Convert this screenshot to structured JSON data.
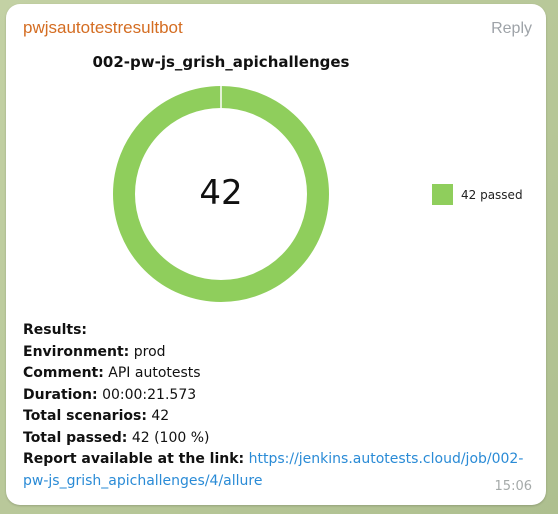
{
  "message": {
    "sender": "pwjsautotestresultbot",
    "reply_label": "Reply",
    "time": "15:06"
  },
  "chart_data": {
    "type": "pie",
    "title": "002-pw-js_grish_apichallenges",
    "center_label": "42",
    "slices": [
      {
        "label": "42 passed",
        "value": 42,
        "color": "#8fce5c"
      }
    ]
  },
  "results": {
    "heading": "Results:",
    "environment_key": "Environment:",
    "environment_value": "prod",
    "comment_key": "Comment:",
    "comment_value": "API autotests",
    "duration_key": "Duration:",
    "duration_value": "00:00:21.573",
    "total_scenarios_key": "Total scenarios:",
    "total_scenarios_value": "42",
    "total_passed_key": "Total passed:",
    "total_passed_value": "42 (100 %)",
    "report_key": "Report available at the link:",
    "report_link": "https://jenkins.autotests.cloud/job/002-pw-js_grish_apichallenges/4/allure"
  }
}
